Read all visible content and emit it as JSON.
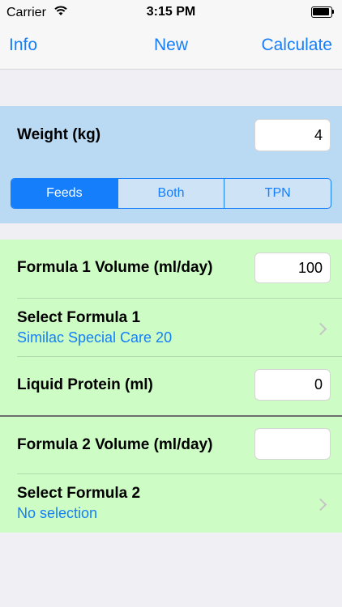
{
  "status_bar": {
    "carrier": "Carrier",
    "time": "3:15 PM"
  },
  "nav": {
    "info_label": "Info",
    "new_label": "New",
    "calculate_label": "Calculate"
  },
  "weight": {
    "label": "Weight (kg)",
    "value": "4"
  },
  "mode_segments": {
    "items": [
      "Feeds",
      "Both",
      "TPN"
    ],
    "selected": "Feeds"
  },
  "formula1": {
    "volume_label": "Formula 1 Volume (ml/day)",
    "volume_value": "100",
    "select_label": "Select Formula 1",
    "selected_value": "Similac Special Care 20"
  },
  "liquid_protein": {
    "label": "Liquid Protein (ml)",
    "value": "0"
  },
  "formula2": {
    "volume_label": "Formula 2 Volume (ml/day)",
    "volume_value": "",
    "select_label": "Select Formula 2",
    "selected_value": "No selection"
  },
  "colors": {
    "accent": "#147efb",
    "weight_bg": "#bad9f3",
    "formula_bg": "#cdfdc4",
    "page_bg": "#efeff4"
  }
}
